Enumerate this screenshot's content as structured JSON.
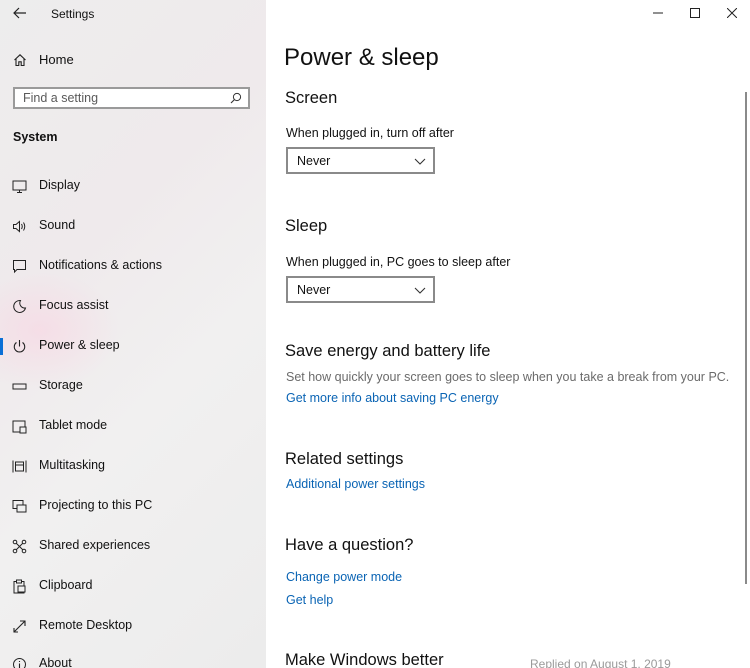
{
  "window": {
    "title": "Settings",
    "controls": [
      "minimize",
      "maximize",
      "close"
    ]
  },
  "sidebar": {
    "home_label": "Home",
    "search_placeholder": "Find a setting",
    "section": "System",
    "items": [
      {
        "label": "Display",
        "icon": "display-icon"
      },
      {
        "label": "Sound",
        "icon": "sound-icon"
      },
      {
        "label": "Notifications & actions",
        "icon": "notifications-icon"
      },
      {
        "label": "Focus assist",
        "icon": "focus-assist-icon"
      },
      {
        "label": "Power & sleep",
        "icon": "power-icon",
        "selected": true
      },
      {
        "label": "Storage",
        "icon": "storage-icon"
      },
      {
        "label": "Tablet mode",
        "icon": "tablet-mode-icon"
      },
      {
        "label": "Multitasking",
        "icon": "multitasking-icon"
      },
      {
        "label": "Projecting to this PC",
        "icon": "projecting-icon"
      },
      {
        "label": "Shared experiences",
        "icon": "shared-experiences-icon"
      },
      {
        "label": "Clipboard",
        "icon": "clipboard-icon"
      },
      {
        "label": "Remote Desktop",
        "icon": "remote-desktop-icon"
      },
      {
        "label": "About",
        "icon": "about-icon"
      }
    ]
  },
  "main": {
    "page_title": "Power & sleep",
    "screen": {
      "heading": "Screen",
      "label": "When plugged in, turn off after",
      "value": "Never"
    },
    "sleep": {
      "heading": "Sleep",
      "label": "When plugged in, PC goes to sleep after",
      "value": "Never"
    },
    "save_energy": {
      "heading": "Save energy and battery life",
      "description": "Set how quickly your screen goes to sleep when you take a break from your PC.",
      "link": "Get more info about saving PC energy"
    },
    "related": {
      "heading": "Related settings",
      "link": "Additional power settings"
    },
    "question": {
      "heading": "Have a question?",
      "links": [
        "Change power mode",
        "Get help"
      ]
    },
    "make_better": {
      "heading": "Make Windows better"
    }
  },
  "footer_text": "Replied on August 1, 2019",
  "colors": {
    "accent": "#0a6fd6",
    "link": "#0a64b4",
    "sidebar_bg": "#eeeeee"
  }
}
